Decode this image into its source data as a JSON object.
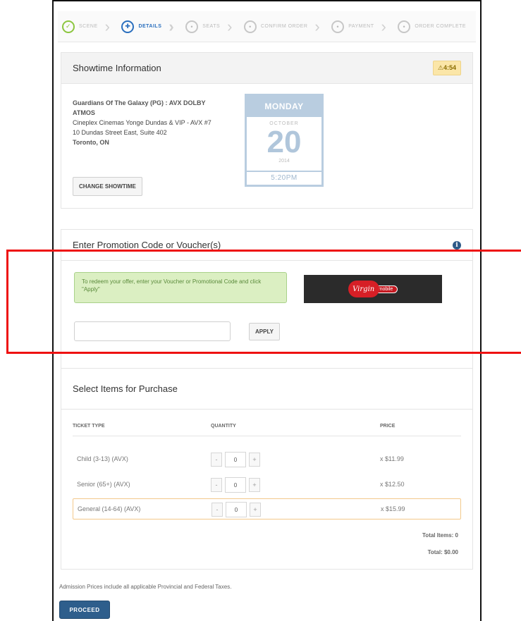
{
  "steps": [
    {
      "label": "SCENE",
      "status": "done",
      "glyph": "✓"
    },
    {
      "label": "DETAILS",
      "status": "active",
      "glyph": "✚"
    },
    {
      "label": "SEATS",
      "status": "todo",
      "glyph": "•"
    },
    {
      "label": "CONFIRM ORDER",
      "status": "todo",
      "glyph": "•"
    },
    {
      "label": "PAYMENT",
      "status": "todo",
      "glyph": "•"
    },
    {
      "label": "ORDER COMPLETE",
      "status": "todo",
      "glyph": "•"
    }
  ],
  "showtime": {
    "title": "Showtime Information",
    "rating": "⚠4:54",
    "movie": "Guardians Of The Galaxy (PG) : AVX DOLBY ATMOS",
    "cinema": "Cineplex Cinemas Yonge Dundas & VIP - AVX #7",
    "address": "10 Dundas Street East, Suite 402",
    "city": "Toronto, ON",
    "change_button": "CHANGE SHOWTIME",
    "calendar": {
      "day": "MONDAY",
      "month": "OCTOBER",
      "date": "20",
      "year": "2014",
      "time": "5:20PM"
    }
  },
  "promo": {
    "title": "Enter Promotion Code or Voucher(s)",
    "info_icon": "i",
    "message": "To redeem your offer, enter your Voucher or Promotional Code and click \"Apply\"",
    "input_value": "",
    "input_placeholder": "",
    "apply_button": "APPLY",
    "partner_logo": "Virgin",
    "partner_sub": "mobile"
  },
  "purchase": {
    "title": "Select Items for Purchase",
    "columns": {
      "type": "TICKET TYPE",
      "quantity": "QUANTITY",
      "price": "PRICE"
    },
    "rows": [
      {
        "type": "Child (3-13) (AVX)",
        "qty": "0",
        "price": "x $11.99"
      },
      {
        "type": "Senior (65+) (AVX)",
        "qty": "0",
        "price": "x $12.50"
      },
      {
        "type": "General (14-64) (AVX)",
        "qty": "0",
        "price": "x $15.99"
      }
    ],
    "minus": "-",
    "plus": "+",
    "total_items": "Total Items: 0",
    "total": "Total: $0.00"
  },
  "footer": {
    "note": "Admission Prices include all applicable Provincial and Federal Taxes.",
    "proceed_button": "PROCEED"
  },
  "colors": {
    "accent": "#2e5e8c",
    "success": "#8cc63f",
    "highlight": "#ee1111"
  }
}
